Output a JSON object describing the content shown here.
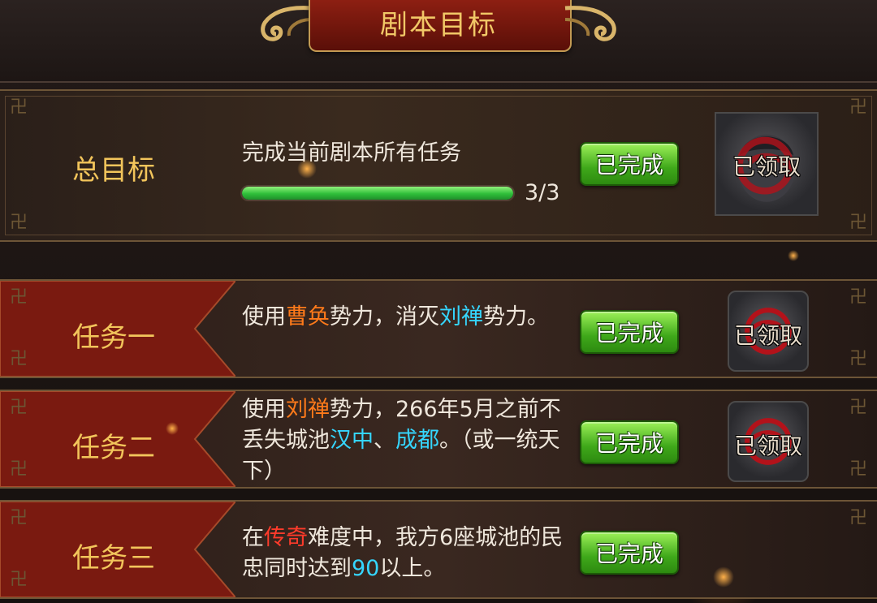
{
  "header": {
    "title": "剧本目标"
  },
  "overall": {
    "label": "总目标",
    "description": "完成当前剧本所有任务",
    "progress_text": "3/3",
    "progress_fraction": 1.0,
    "status_button": "已完成",
    "reward_status": "已领取"
  },
  "tasks": [
    {
      "label": "任务一",
      "desc_parts": [
        "使用",
        "曹奂",
        "势力，消灭",
        "刘禅",
        "势力。"
      ],
      "status_button": "已完成",
      "reward_status": "已领取"
    },
    {
      "label": "任务二",
      "desc_parts": [
        "使用",
        "刘禅",
        "势力，266年5月之前不丢失城池",
        "汉中",
        "、",
        "成都",
        "。（或一统天下）"
      ],
      "status_button": "已完成",
      "reward_status": "已领取"
    },
    {
      "label": "任务三",
      "desc_parts": [
        "在",
        "传奇",
        "难度中，我方6座城池的民忠同时达到",
        "90",
        "以上。"
      ],
      "status_button": "已完成"
    }
  ],
  "colors": {
    "title_gold": "#f1c867",
    "highlight_orange": "#ff7a1a",
    "highlight_red": "#ff3b2b",
    "highlight_cyan": "#35d6ff",
    "button_green": "#3fa81a"
  },
  "icons": [
    "cloud-scroll-ornament-icon",
    "fret-corner-icon",
    "general-portrait-icon"
  ]
}
